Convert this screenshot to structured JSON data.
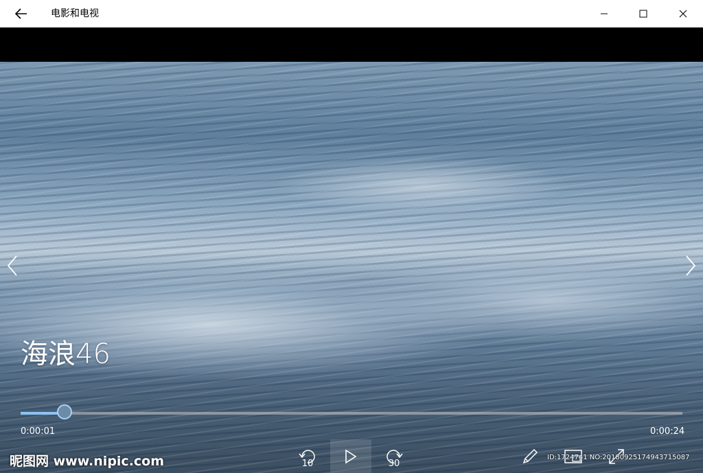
{
  "app": {
    "title": "电影和电视"
  },
  "window_controls": {
    "back_icon": "back-arrow-icon",
    "minimize_icon": "minimize-icon",
    "maximize_icon": "maximize-icon",
    "close_icon": "close-icon"
  },
  "player": {
    "video_title": "海浪46",
    "current_time": "0:00:01",
    "duration": "0:00:24",
    "progress_fraction": 0.066,
    "skip_back_label": "10",
    "skip_forward_label": "30"
  },
  "watermark": {
    "site": "昵图网 www.nipic.com",
    "id_text": "ID:1724741 NO:20180925174943715087"
  },
  "colors": {
    "accent": "#8ec2f2",
    "titlebar_bg": "#ffffff",
    "video_bg": "#000000"
  }
}
